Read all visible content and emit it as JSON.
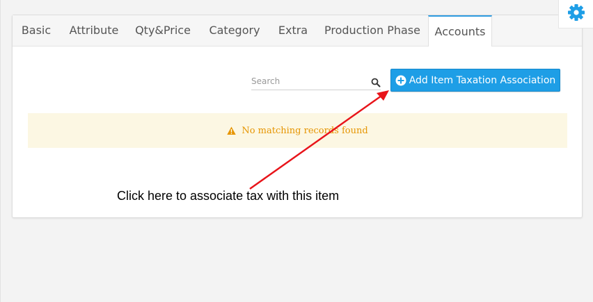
{
  "tabs": [
    {
      "label": "Basic"
    },
    {
      "label": "Attribute"
    },
    {
      "label": "Qty&Price"
    },
    {
      "label": "Category"
    },
    {
      "label": "Extra"
    },
    {
      "label": "Production Phase"
    },
    {
      "label": "Accounts",
      "active": true
    }
  ],
  "search": {
    "placeholder": "Search",
    "icon": "search-icon"
  },
  "add_button": {
    "label": "Add Item Taxation Association",
    "icon": "plus-circle-icon"
  },
  "alert": {
    "message": "No matching records found",
    "icon": "warning-icon"
  },
  "annotation": {
    "text": "Click here to associate tax with this item"
  },
  "settings": {
    "icon": "gear-icon"
  },
  "colors": {
    "accent": "#1e9ee6",
    "warning": "#e69500",
    "alert_bg": "#fcf7e3",
    "arrow": "#e8141a"
  }
}
